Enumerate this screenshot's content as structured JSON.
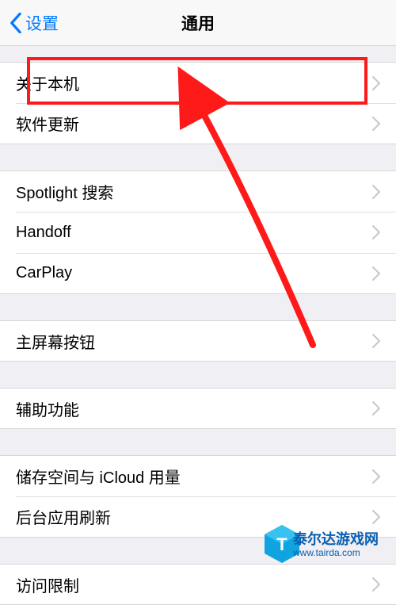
{
  "nav": {
    "back": "设置",
    "title": "通用"
  },
  "groups": [
    {
      "rows": [
        "关于本机",
        "软件更新"
      ]
    },
    {
      "rows": [
        "Spotlight 搜索",
        "Handoff",
        "CarPlay"
      ]
    },
    {
      "rows": [
        "主屏幕按钮"
      ]
    },
    {
      "rows": [
        "辅助功能"
      ]
    },
    {
      "rows": [
        "储存空间与 iCloud 用量",
        "后台应用刷新"
      ]
    },
    {
      "rows": [
        "访问限制"
      ]
    }
  ],
  "highlight": {
    "row_index": 0
  },
  "watermark": {
    "name": "泰尔达游戏网",
    "url": "www.tairda.com"
  }
}
